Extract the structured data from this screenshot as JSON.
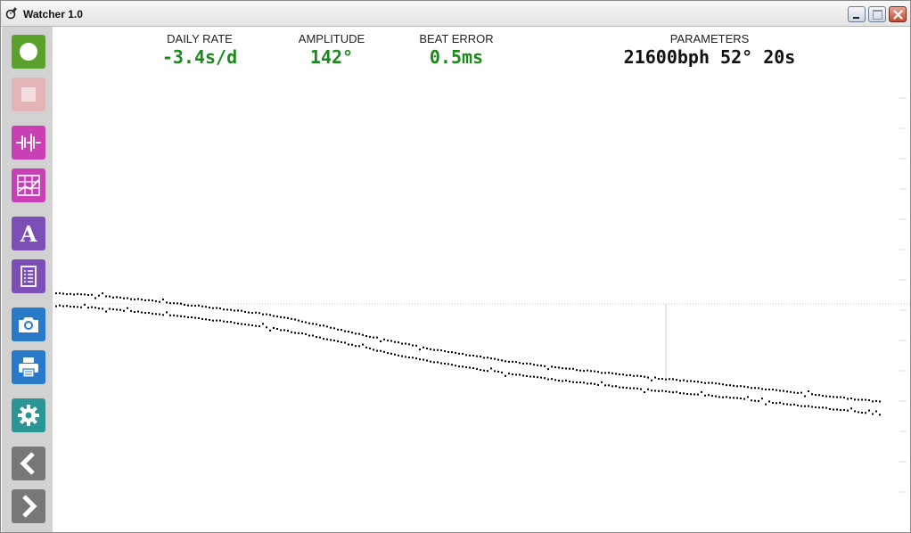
{
  "window": {
    "title": "Watcher 1.0",
    "app_icon": "watch-app-icon",
    "controls": [
      "minimize",
      "maximize",
      "close"
    ]
  },
  "toolbar": {
    "items": [
      {
        "name": "start",
        "icon": "record-icon",
        "color": "#5aa02c",
        "enabled": true
      },
      {
        "name": "stop",
        "icon": "stop-icon",
        "color": "#e3b5b7",
        "enabled": false
      },
      {
        "name": "waveform",
        "icon": "waveform-icon",
        "color": "#c940b4",
        "enabled": true
      },
      {
        "name": "chart",
        "icon": "chart-grid-icon",
        "color": "#c940b4",
        "enabled": true
      },
      {
        "name": "font",
        "icon": "font-icon",
        "color": "#7b4fb5",
        "enabled": true
      },
      {
        "name": "report",
        "icon": "document-icon",
        "color": "#7b4fb5",
        "enabled": true
      },
      {
        "name": "snapshot",
        "icon": "camera-icon",
        "color": "#2979c9",
        "enabled": true
      },
      {
        "name": "print",
        "icon": "printer-icon",
        "color": "#2979c9",
        "enabled": true
      },
      {
        "name": "settings",
        "icon": "gear-icon",
        "color": "#2b9494",
        "enabled": true
      },
      {
        "name": "previous",
        "icon": "chevron-left-icon",
        "color": "#777777",
        "enabled": true
      },
      {
        "name": "next",
        "icon": "chevron-right-icon",
        "color": "#777777",
        "enabled": true
      }
    ]
  },
  "metrics": {
    "daily_rate": {
      "label": "DAILY RATE",
      "value": "-3.4s/d"
    },
    "amplitude": {
      "label": "AMPLITUDE",
      "value": "142°"
    },
    "beat_error": {
      "label": "BEAT ERROR",
      "value": "0.5ms"
    },
    "parameters": {
      "label": "PARAMETERS",
      "value": "21600bph 52° 20s"
    }
  },
  "colors": {
    "metric_value": "#1a8a1a",
    "trace": "#000000",
    "guide_line": "#c8c8c8"
  },
  "chart_data": {
    "type": "scatter",
    "title": "",
    "xlabel": "",
    "ylabel": "",
    "grid": false,
    "description_free": true,
    "series": [
      {
        "points": [
          [
            0,
            0.0
          ],
          [
            0.05,
            0.3
          ],
          [
            0.1,
            0.8
          ],
          [
            0.15,
            1.4
          ],
          [
            0.2,
            2.0
          ],
          [
            0.25,
            2.7
          ],
          [
            0.3,
            3.7
          ],
          [
            0.35,
            4.9
          ],
          [
            0.4,
            6.1
          ],
          [
            0.45,
            7.2
          ],
          [
            0.5,
            8.1
          ],
          [
            0.55,
            8.9
          ],
          [
            0.6,
            9.6
          ],
          [
            0.65,
            10.2
          ],
          [
            0.7,
            10.8
          ],
          [
            0.75,
            11.3
          ],
          [
            0.8,
            11.8
          ],
          [
            0.85,
            12.4
          ],
          [
            0.9,
            13.0
          ],
          [
            0.95,
            13.6
          ],
          [
            1.0,
            14.2
          ]
        ]
      },
      {
        "points": [
          [
            0,
            0.0
          ],
          [
            0.05,
            0.3
          ],
          [
            0.1,
            0.8
          ],
          [
            0.15,
            1.4
          ],
          [
            0.2,
            2.0
          ],
          [
            0.25,
            2.7
          ],
          [
            0.3,
            3.7
          ],
          [
            0.35,
            4.9
          ],
          [
            0.4,
            6.1
          ],
          [
            0.45,
            7.2
          ],
          [
            0.5,
            8.1
          ],
          [
            0.55,
            8.9
          ],
          [
            0.6,
            9.6
          ],
          [
            0.65,
            10.2
          ],
          [
            0.7,
            10.8
          ],
          [
            0.75,
            11.3
          ],
          [
            0.8,
            11.8
          ],
          [
            0.85,
            12.4
          ],
          [
            0.9,
            13.0
          ],
          [
            0.95,
            13.6
          ],
          [
            1.0,
            14.2
          ]
        ]
      }
    ]
  }
}
